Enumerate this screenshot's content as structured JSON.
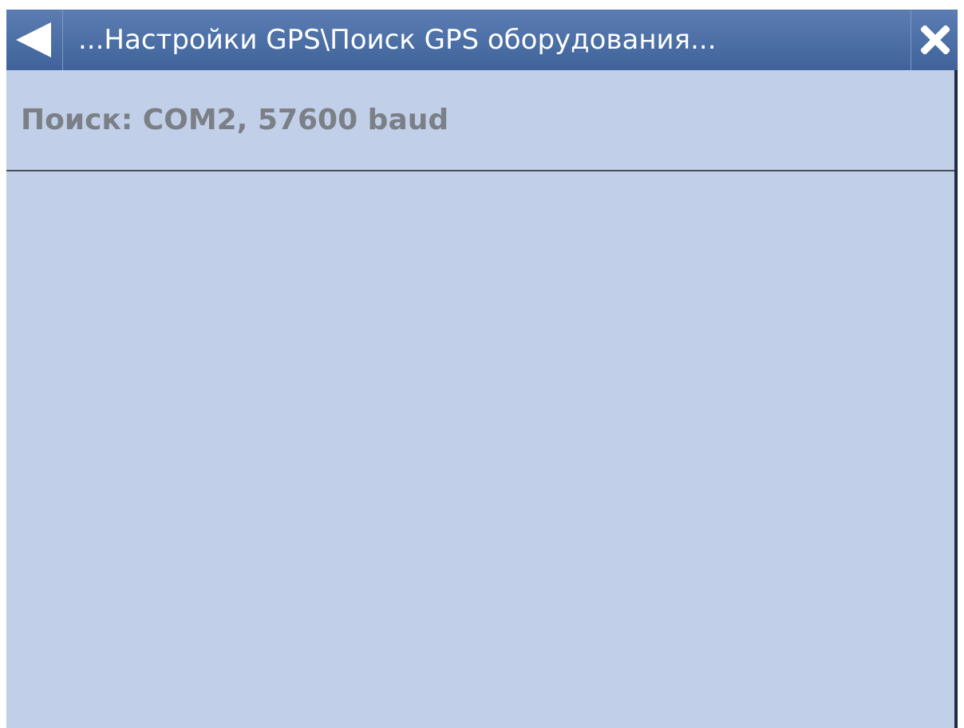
{
  "titlebar": {
    "title": "...Настройки GPS\\Поиск GPS оборудования..."
  },
  "content": {
    "status": "Поиск: COM2, 57600 baud"
  },
  "icons": {
    "back": "back-arrow-icon",
    "close": "close-icon"
  },
  "colors": {
    "titlebar": "#4a6ea5",
    "background": "#c1cfe8",
    "status_text": "#7b7f86"
  }
}
